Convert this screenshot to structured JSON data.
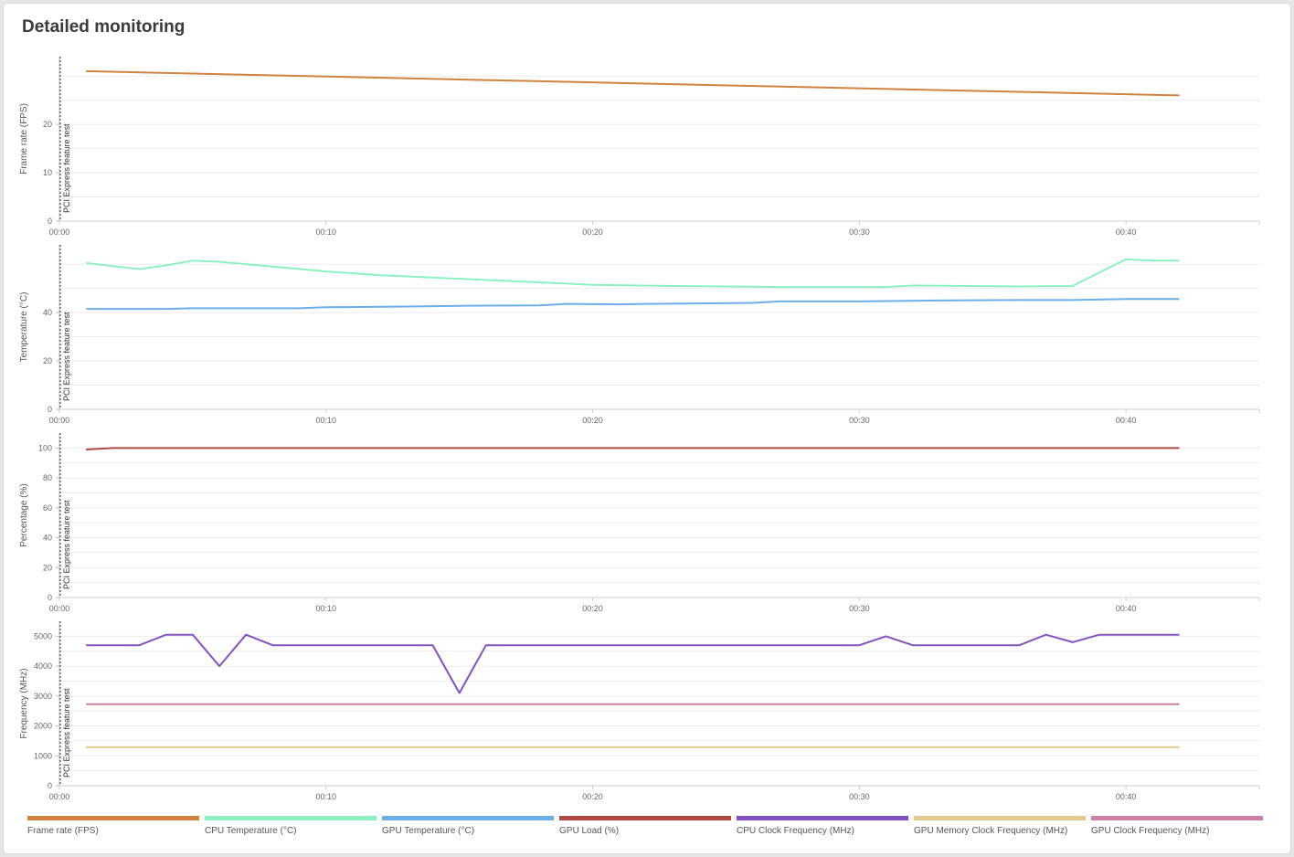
{
  "title": "Detailed monitoring",
  "marker_label": "PCI Express feature test",
  "legend": [
    {
      "label": "Frame rate (FPS)",
      "color": "#d0833e"
    },
    {
      "label": "CPU Temperature (°C)",
      "color": "#8df0c3"
    },
    {
      "label": "GPU Temperature (°C)",
      "color": "#6caee8"
    },
    {
      "label": "GPU Load (%)",
      "color": "#b04a45"
    },
    {
      "label": "CPU Clock Frequency (MHz)",
      "color": "#8452c0"
    },
    {
      "label": "GPU Memory Clock Frequency (MHz)",
      "color": "#e0c98a"
    },
    {
      "label": "GPU Clock Frequency (MHz)",
      "color": "#cc7fa2"
    }
  ],
  "chart_data": [
    {
      "type": "line",
      "ylabel": "Frame rate (FPS)",
      "xlim": [
        0,
        45
      ],
      "ylim": [
        0,
        34
      ],
      "yticks": [
        0,
        10,
        20
      ],
      "xticks": [
        "00:00",
        "00:10",
        "00:20",
        "00:30",
        "00:40"
      ],
      "series": [
        {
          "name": "Frame rate (FPS)",
          "color": "#d0833e",
          "x": [
            1,
            42
          ],
          "y": [
            31,
            26
          ]
        }
      ]
    },
    {
      "type": "line",
      "ylabel": "Temperature (°C)",
      "xlim": [
        0,
        45
      ],
      "ylim": [
        0,
        68
      ],
      "yticks": [
        0,
        20,
        40
      ],
      "xticks": [
        "00:00",
        "00:10",
        "00:20",
        "00:30",
        "00:40"
      ],
      "series": [
        {
          "name": "CPU Temperature (°C)",
          "color": "#8df0c3",
          "x": [
            1,
            3,
            4,
            5,
            6,
            8,
            10,
            12,
            15,
            18,
            20,
            23,
            25,
            27,
            30,
            31,
            32,
            34,
            36,
            38,
            40,
            41,
            42
          ],
          "y": [
            60.5,
            58,
            59.5,
            61.5,
            61,
            59,
            57,
            55.5,
            54,
            52.5,
            51.5,
            51,
            50.8,
            50.6,
            50.6,
            50.6,
            51.2,
            51,
            50.8,
            51,
            62,
            61.5,
            61.5
          ]
        },
        {
          "name": "GPU Temperature (°C)",
          "color": "#6caee8",
          "x": [
            1,
            4,
            5,
            9,
            10,
            13,
            15,
            18,
            19,
            21,
            22,
            26,
            27,
            30,
            33,
            36,
            38,
            40,
            42
          ],
          "y": [
            41.5,
            41.5,
            41.8,
            41.8,
            42.2,
            42.5,
            42.8,
            43,
            43.6,
            43.4,
            43.6,
            44,
            44.6,
            44.6,
            45,
            45.2,
            45.2,
            45.6,
            45.6
          ]
        }
      ]
    },
    {
      "type": "line",
      "ylabel": "Percentage (%)",
      "xlim": [
        0,
        45
      ],
      "ylim": [
        0,
        110
      ],
      "yticks": [
        0,
        20,
        40,
        60,
        80,
        100
      ],
      "xticks": [
        "00:00",
        "00:10",
        "00:20",
        "00:30",
        "00:40"
      ],
      "series": [
        {
          "name": "GPU Load (%)",
          "color": "#b04a45",
          "x": [
            1,
            2,
            42
          ],
          "y": [
            99,
            100,
            100
          ]
        }
      ]
    },
    {
      "type": "line",
      "ylabel": "Frequency (MHz)",
      "xlim": [
        0,
        45
      ],
      "ylim": [
        0,
        5500
      ],
      "yticks": [
        0,
        1000,
        2000,
        3000,
        4000,
        5000
      ],
      "xticks": [
        "00:00",
        "00:10",
        "00:20",
        "00:30",
        "00:40"
      ],
      "series": [
        {
          "name": "CPU Clock Frequency (MHz)",
          "color": "#8452c0",
          "x": [
            1,
            3,
            4,
            5,
            6,
            7,
            8,
            14,
            15,
            16,
            30,
            31,
            32,
            36,
            37,
            38,
            39,
            40,
            42
          ],
          "y": [
            4700,
            4700,
            5050,
            5050,
            4000,
            5050,
            4700,
            4700,
            3100,
            4700,
            4700,
            5000,
            4700,
            4700,
            5050,
            4800,
            5050,
            5050,
            5050
          ]
        },
        {
          "name": "GPU Clock Frequency (MHz)",
          "color": "#cc7fa2",
          "x": [
            1,
            42
          ],
          "y": [
            2730,
            2730
          ]
        },
        {
          "name": "GPU Memory Clock Frequency (MHz)",
          "color": "#e0c98a",
          "x": [
            1,
            42
          ],
          "y": [
            1290,
            1290
          ]
        }
      ]
    }
  ]
}
